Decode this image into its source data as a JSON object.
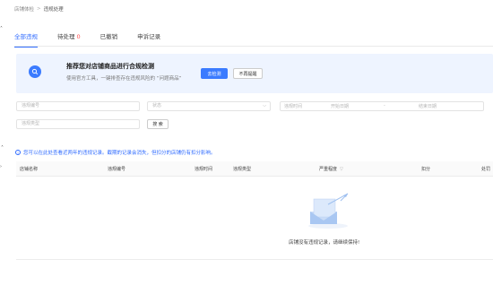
{
  "breadcrumb": {
    "parent": "店铺体检",
    "separator": ">",
    "current": "违规处理"
  },
  "tabs": [
    {
      "label": "全部违规",
      "count": ""
    },
    {
      "label": "待处理",
      "count": "0"
    },
    {
      "label": "已撤销",
      "count": ""
    },
    {
      "label": "申诉记录",
      "count": ""
    }
  ],
  "banner": {
    "title": "推荐您对店铺商品进行合规检测",
    "desc": "使用官方工具，一键排查存在违规风险的 “问题商品”",
    "primary_button": "去检测",
    "secondary_button": "不再提醒"
  },
  "filters": {
    "violation_no_placeholder": "违规编号",
    "status_placeholder": "状态",
    "violation_time_label": "违规时间",
    "start_date_placeholder": "开始日期",
    "date_separator": "-",
    "end_date_placeholder": "结束日期",
    "violation_type_placeholder": "违规类型",
    "search_button": "搜 索"
  },
  "notice": "您可以在此处查看近两年的违规记录。截期的记录会消失，但扣分的店铺仍有扣分影响。",
  "table": {
    "columns": [
      "店铺名称",
      "违规编号",
      "违规时间",
      "违规类型",
      "严重程度",
      "扣分",
      "处罚"
    ]
  },
  "empty_state": {
    "text": "店铺没有违规记录，请继续保持!"
  },
  "colors": {
    "accent": "#2f6bff",
    "banner_bg": "#eef4ff",
    "badge": "#ff4d4f"
  }
}
